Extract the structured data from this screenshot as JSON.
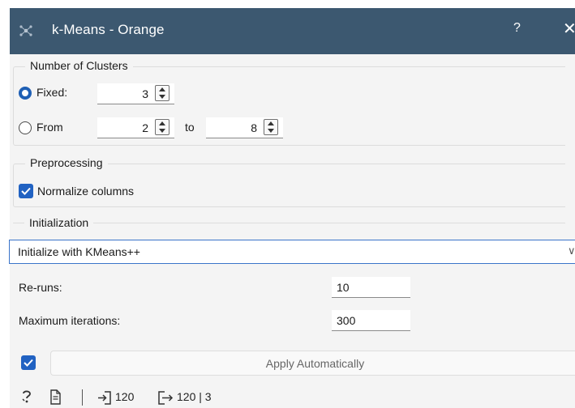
{
  "window": {
    "title": "k-Means - Orange",
    "help_label": "?",
    "close_label": "✕"
  },
  "clusters": {
    "group_title": "Number of Clusters",
    "mode": "Fixed",
    "fixed_label": "Fixed:",
    "fixed_value": "3",
    "from_label": "From",
    "from_value": "2",
    "to_label": "to",
    "to_value": "8"
  },
  "preprocessing": {
    "group_title": "Preprocessing",
    "normalize_label": "Normalize columns",
    "normalize_checked": true
  },
  "initialization": {
    "group_title": "Initialization",
    "method": "Initialize with KMeans++",
    "reruns_label": "Re-runs:",
    "reruns_value": "10",
    "max_iter_label": "Maximum iterations:",
    "max_iter_value": "300"
  },
  "apply": {
    "auto_checked": true,
    "label": "Apply Automatically"
  },
  "status_bar": {
    "input_count": "120",
    "output_count": "120 | 3"
  },
  "colors": {
    "titlebar": "#3c5870",
    "accent": "#2162c2",
    "panel": "#f4f4f4"
  }
}
